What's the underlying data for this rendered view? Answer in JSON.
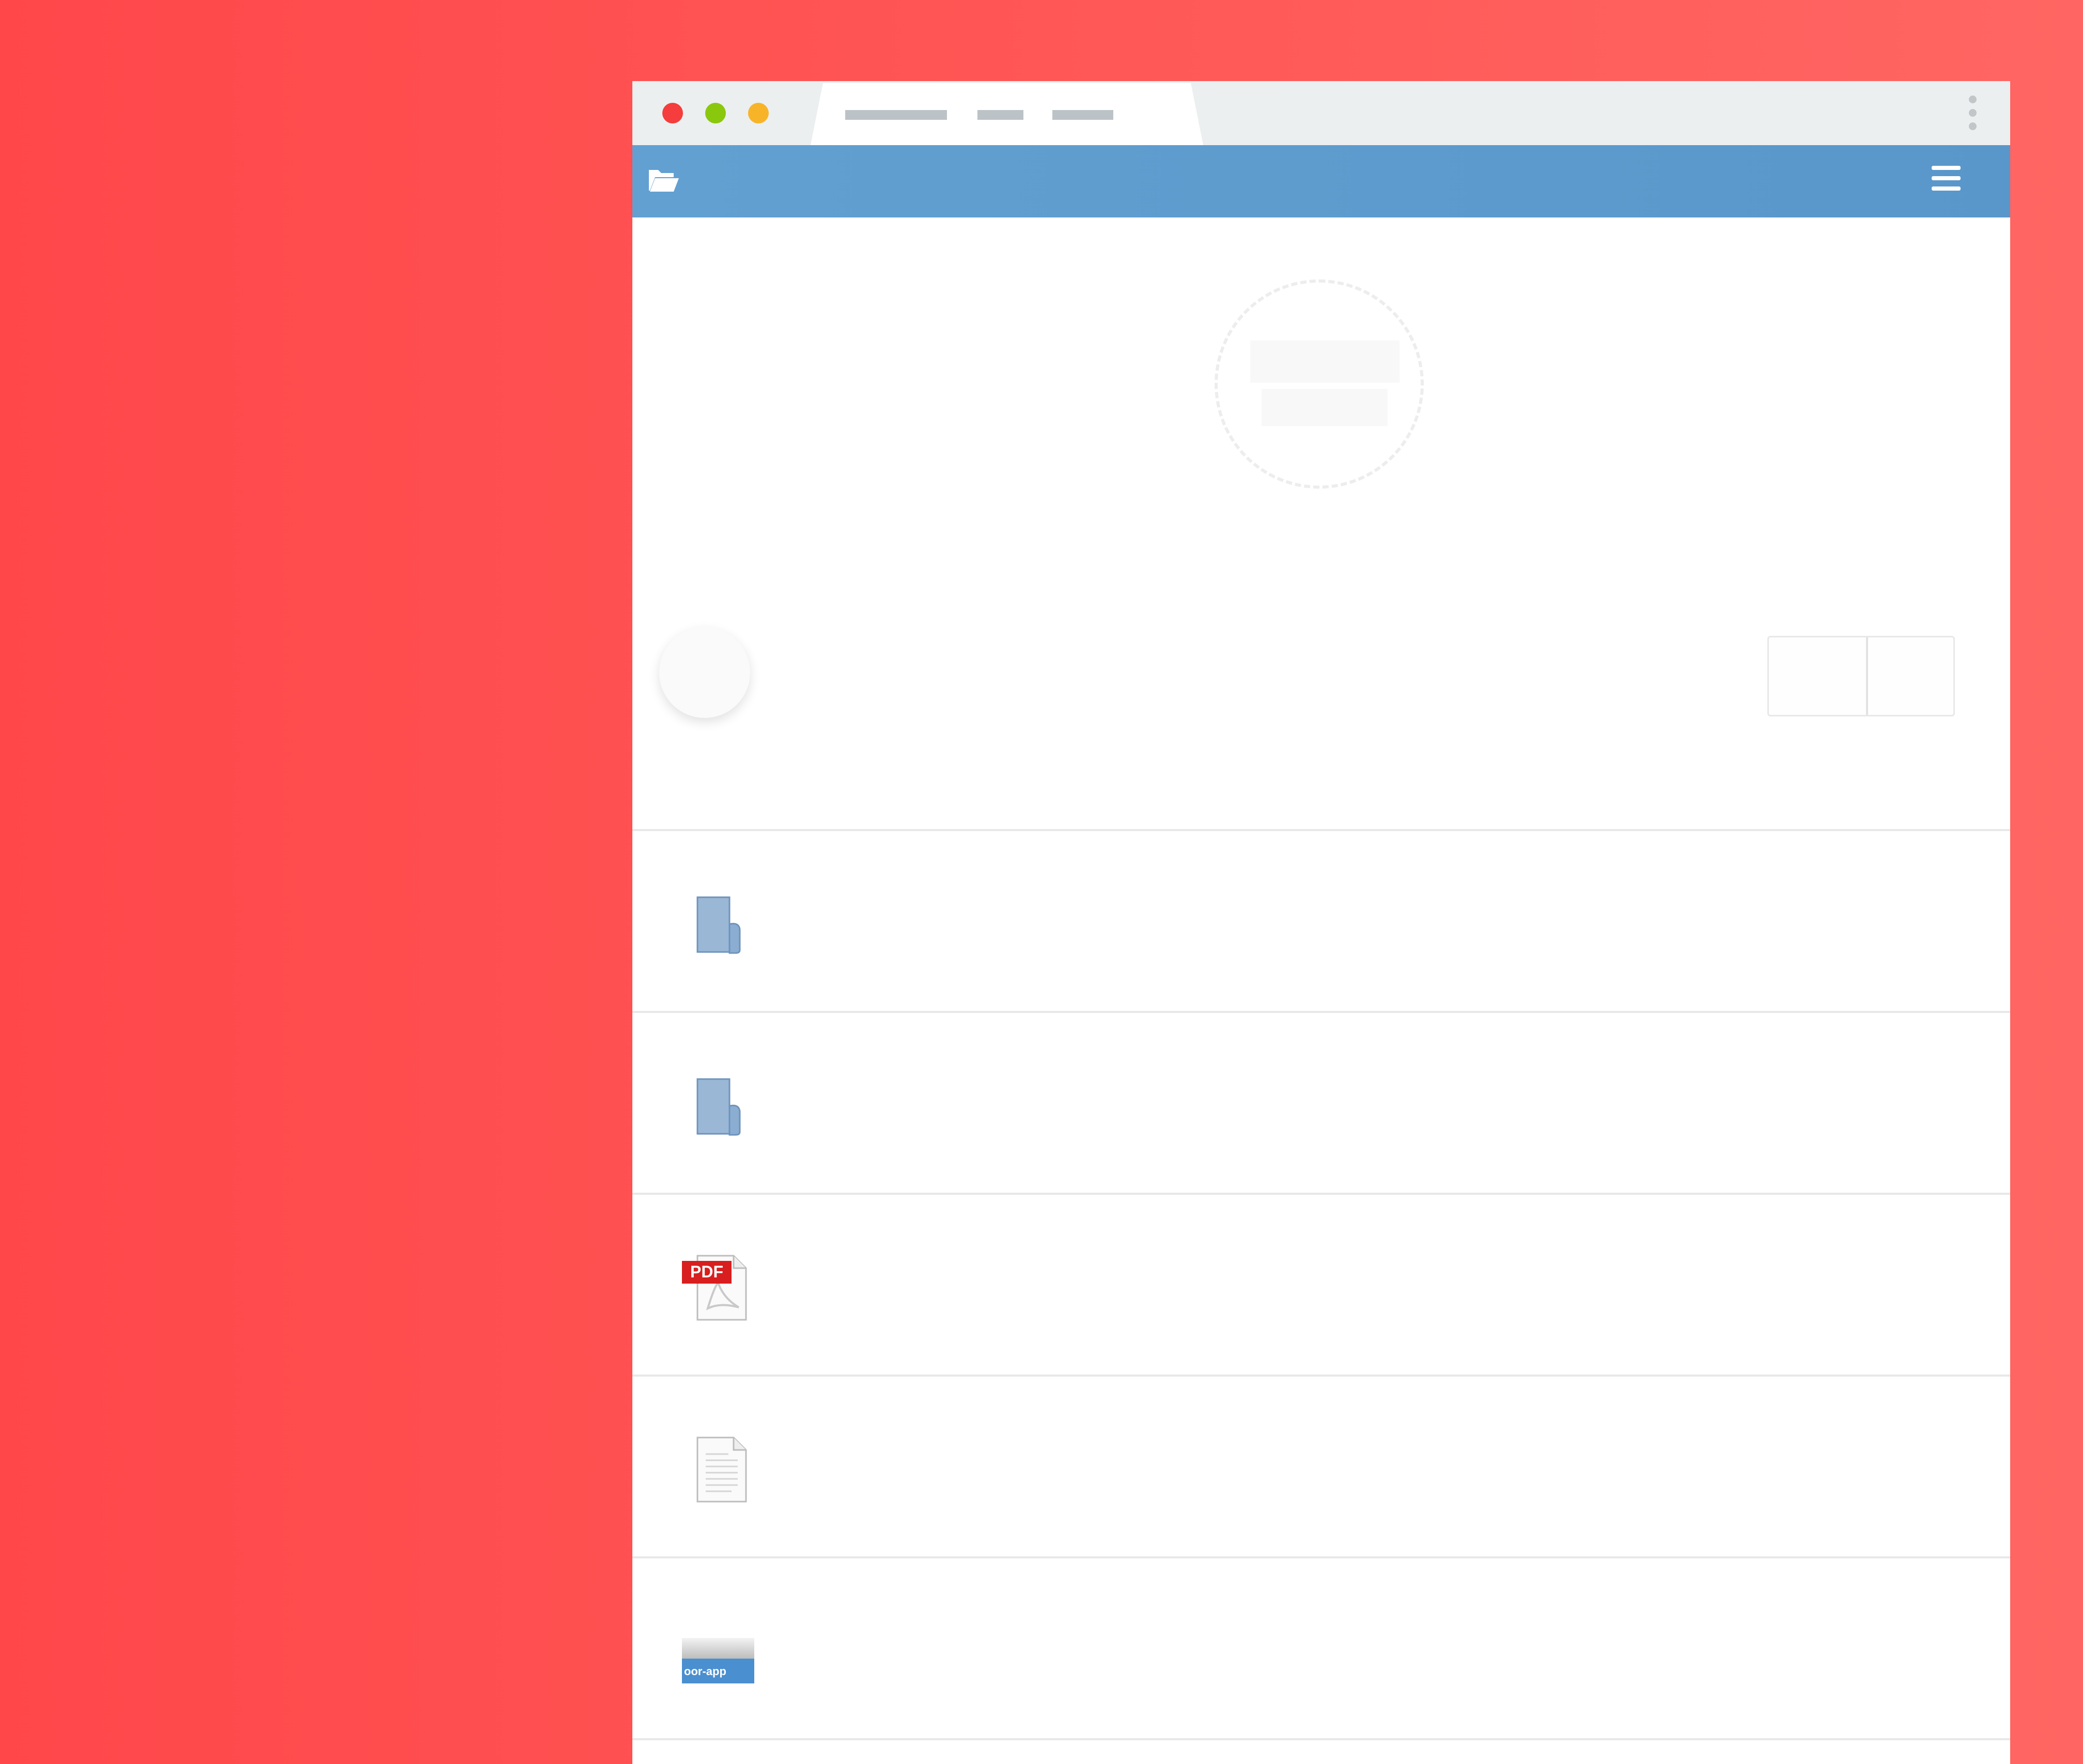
{
  "window": {
    "controls": [
      "close",
      "minimize",
      "maximize"
    ],
    "tab": {
      "title": ""
    }
  },
  "appbar": {
    "logo_icon": "folder-open-icon",
    "menu_icon": "hamburger-menu-icon",
    "color": "#5b9ccf"
  },
  "upload": {
    "title": "",
    "subtitle": ""
  },
  "view_toggle": {
    "options": [
      "",
      ""
    ]
  },
  "files": [
    {
      "type": "folder",
      "icon": "folder-icon",
      "name": "",
      "meta": ""
    },
    {
      "type": "folder",
      "icon": "folder-icon",
      "name": "",
      "meta": ""
    },
    {
      "type": "pdf",
      "icon": "pdf-file-icon",
      "icon_label": "PDF",
      "name": "",
      "meta": ""
    },
    {
      "type": "text",
      "icon": "text-file-icon",
      "name": "",
      "meta": ""
    },
    {
      "type": "image",
      "icon": "image-file-icon",
      "icon_label": "oor-app",
      "name": "",
      "meta": ""
    }
  ],
  "colors": {
    "background": "#ff5252",
    "titlebar": "#eceff0",
    "accent": "#5b9ccf",
    "close": "#f43d3c",
    "minimize": "#8ac80e",
    "maximize": "#f8b428"
  }
}
